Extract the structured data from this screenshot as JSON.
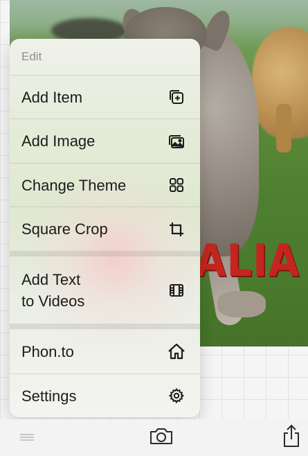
{
  "photo": {
    "overlay_text": "ALIA",
    "overlay_color": "#c4261f"
  },
  "menu": {
    "header": "Edit",
    "groups": [
      [
        {
          "label": "Add Item",
          "icon": "add-item-icon"
        },
        {
          "label": "Add Image",
          "icon": "add-image-icon"
        },
        {
          "label": "Change Theme",
          "icon": "grid-icon"
        },
        {
          "label": "Square Crop",
          "icon": "crop-icon"
        }
      ],
      [
        {
          "label_line1": "Add Text",
          "label_line2": "to Videos",
          "icon": "film-icon"
        }
      ],
      [
        {
          "label": "Phon.to",
          "icon": "home-icon"
        },
        {
          "label": "Settings",
          "icon": "gear-icon"
        }
      ]
    ]
  },
  "toolbar": {
    "items": [
      {
        "icon": "menu-lines-icon"
      },
      {
        "icon": "camera-icon"
      },
      {
        "icon": "share-icon"
      }
    ]
  }
}
